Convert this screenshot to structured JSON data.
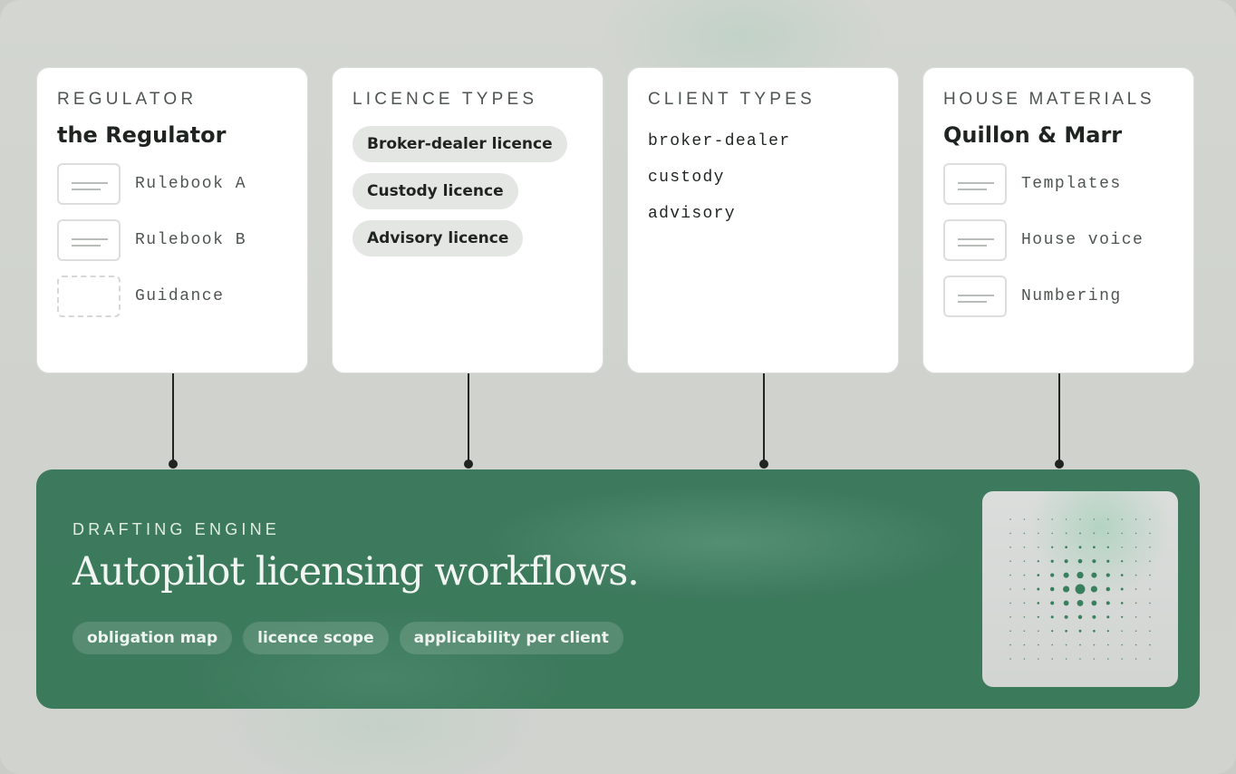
{
  "colors": {
    "background": "#cfd2cd",
    "card": "#ffffff",
    "engine_green": "#3c7a5c",
    "ink": "#1f2421",
    "muted": "#4f5551",
    "pill": "#e3e6e2",
    "radar_dot": "#2f7a57"
  },
  "regulator": {
    "label": "REGULATOR",
    "title": "the Regulator",
    "items": [
      {
        "label": "Rulebook A",
        "icon": "document-icon"
      },
      {
        "label": "Rulebook B",
        "icon": "document-icon"
      },
      {
        "label": "Guidance",
        "icon": "placeholder-document-icon"
      }
    ]
  },
  "licence_types": {
    "label": "LICENCE TYPES",
    "items": [
      "Broker-dealer licence",
      "Custody licence",
      "Advisory licence"
    ]
  },
  "client_types": {
    "label": "CLIENT TYPES",
    "items": [
      "broker-dealer",
      "custody",
      "advisory"
    ]
  },
  "house_materials": {
    "label": "HOUSE MATERIALS",
    "title": "Quillon & Marr",
    "items": [
      {
        "label": "Templates",
        "icon": "document-icon"
      },
      {
        "label": "House voice",
        "icon": "document-icon"
      },
      {
        "label": "Numbering",
        "icon": "document-icon"
      }
    ]
  },
  "engine": {
    "label": "DRAFTING ENGINE",
    "title": "Autopilot licensing workflows.",
    "tags": [
      "obligation map",
      "licence scope",
      "applicability per client"
    ],
    "graphic_icon": "dot-radar-icon"
  }
}
